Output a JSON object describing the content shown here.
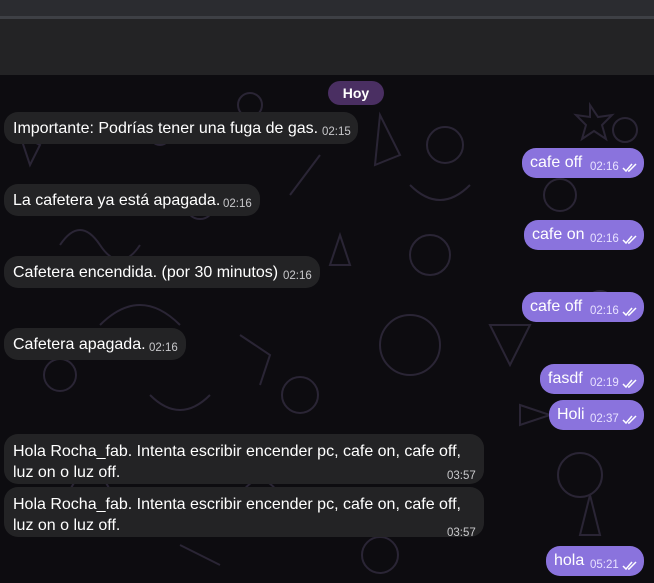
{
  "chat": {
    "date_label": "Hoy",
    "messages": [
      {
        "dir": "in",
        "text": "Importante: Podrías tener una fuga de gas.",
        "time": "02:15"
      },
      {
        "dir": "out",
        "text": "cafe off",
        "time": "02:16"
      },
      {
        "dir": "in",
        "text": "La cafetera ya está apagada.",
        "time": "02:16"
      },
      {
        "dir": "out",
        "text": "cafe on",
        "time": "02:16"
      },
      {
        "dir": "in",
        "text": "Cafetera encendida. (por 30 minutos)",
        "time": "02:16"
      },
      {
        "dir": "out",
        "text": "cafe off",
        "time": "02:16"
      },
      {
        "dir": "in",
        "text": "Cafetera apagada.",
        "time": "02:16"
      },
      {
        "dir": "out",
        "text": "fasdf",
        "time": "02:19"
      },
      {
        "dir": "out",
        "text": "Holi",
        "time": "02:37"
      },
      {
        "dir": "in",
        "text": "Hola Rocha_fab. Intenta escribir encender pc, cafe on, cafe off, luz on o luz off.",
        "time": "03:57"
      },
      {
        "dir": "in",
        "text": "Hola Rocha_fab. Intenta escribir encender pc, cafe on, cafe off, luz on o luz off.",
        "time": "03:57"
      },
      {
        "dir": "out",
        "text": "hola",
        "time": "05:21"
      }
    ]
  },
  "colors": {
    "incoming_bubble": "#232325",
    "outgoing_bubble": "#8a73dd",
    "date_pill": "#4a2f62",
    "chat_background": "#0d0c10"
  },
  "icons": {
    "read_receipt": "double-check-icon"
  }
}
